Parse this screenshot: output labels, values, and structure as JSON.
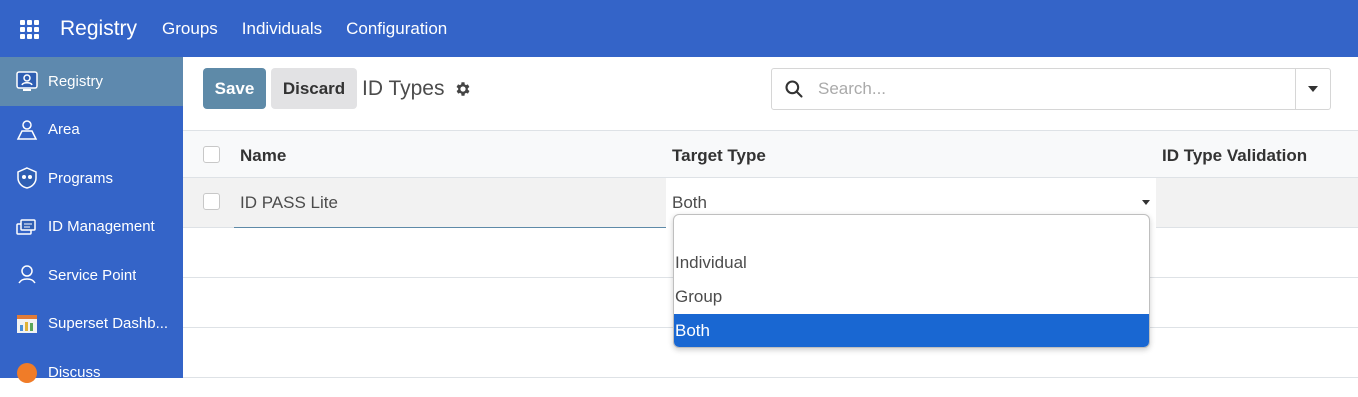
{
  "topbar": {
    "app_name": "Registry",
    "menu": [
      "Groups",
      "Individuals",
      "Configuration"
    ]
  },
  "sidebar": {
    "items": [
      {
        "label": "Registry",
        "icon": "registry-icon",
        "active": true
      },
      {
        "label": "Area",
        "icon": "area-icon",
        "active": false
      },
      {
        "label": "Programs",
        "icon": "programs-icon",
        "active": false
      },
      {
        "label": "ID Management",
        "icon": "id-management-icon",
        "active": false
      },
      {
        "label": "Service Point",
        "icon": "service-point-icon",
        "active": false
      },
      {
        "label": "Superset Dashb...",
        "icon": "dashboard-icon",
        "active": false
      },
      {
        "label": "Discuss",
        "icon": "discuss-icon",
        "active": false
      }
    ]
  },
  "control_panel": {
    "save_label": "Save",
    "discard_label": "Discard",
    "breadcrumb": "ID Types",
    "search_placeholder": "Search..."
  },
  "table": {
    "columns": [
      "Name",
      "Target Type",
      "ID Type Validation"
    ],
    "rows": [
      {
        "name": "ID PASS Lite",
        "target_type": "Both",
        "validation": ""
      }
    ]
  },
  "dropdown": {
    "options": [
      "",
      "Individual",
      "Group",
      "Both"
    ],
    "selected": "Both"
  },
  "colors": {
    "nav_bg": "#3464c8",
    "active_sidebar": "#5e89ae",
    "save_button": "#5e8aa8",
    "selected_option": "#1967d2"
  }
}
